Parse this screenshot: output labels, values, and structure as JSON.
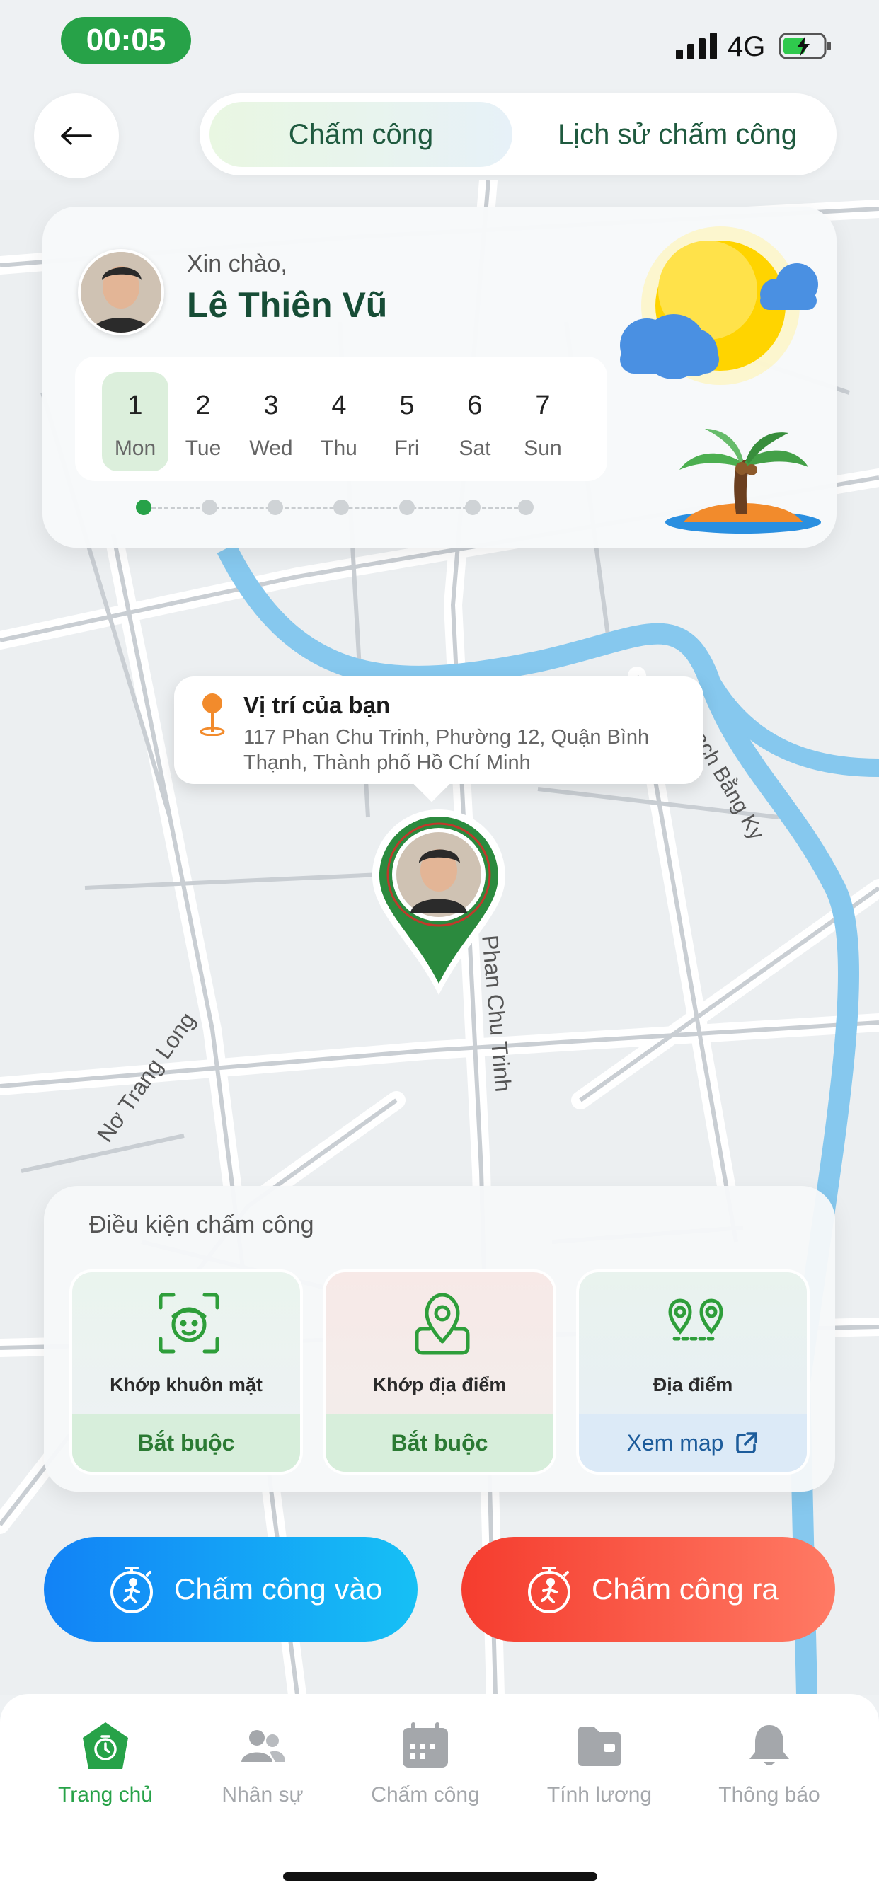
{
  "status_bar": {
    "time": "00:05",
    "network": "4G"
  },
  "header": {
    "tabs": [
      {
        "label": "Chấm công",
        "active": true
      },
      {
        "label": "Lịch sử chấm công",
        "active": false
      }
    ]
  },
  "greeting": {
    "hello": "Xin chào,",
    "name": "Lê Thiên Vũ",
    "week": [
      {
        "num": "1",
        "day": "Mon",
        "active": true
      },
      {
        "num": "2",
        "day": "Tue",
        "active": false
      },
      {
        "num": "3",
        "day": "Wed",
        "active": false
      },
      {
        "num": "4",
        "day": "Thu",
        "active": false
      },
      {
        "num": "5",
        "day": "Fri",
        "active": false
      },
      {
        "num": "6",
        "day": "Sat",
        "active": false
      },
      {
        "num": "7",
        "day": "Sun",
        "active": false
      }
    ]
  },
  "location": {
    "title": "Vị trí của bạn",
    "address": "117 Phan Chu Trinh, Phường 12, Quận Bình Thạnh, Thành phố Hồ Chí Minh"
  },
  "map_labels": {
    "street_1": "Phan Chu Trinh",
    "street_2": "Nơ Trang Long",
    "canal": "Rạch Bằng Ky"
  },
  "conditions": {
    "title": "Điều kiện chấm công",
    "items": [
      {
        "label": "Khớp khuôn mặt",
        "status": "Bắt buộc",
        "icon": "face-scan-icon"
      },
      {
        "label": "Khớp địa điểm",
        "status": "Bắt buộc",
        "icon": "location-pin-icon"
      },
      {
        "label": "Địa điểm",
        "status": "Xem map",
        "icon": "route-pins-icon"
      }
    ]
  },
  "actions": {
    "check_in": "Chấm công vào",
    "check_out": "Chấm công ra"
  },
  "bottom_nav": [
    {
      "label": "Trang chủ",
      "icon": "home-icon",
      "active": true
    },
    {
      "label": "Nhân sự",
      "icon": "people-icon",
      "active": false
    },
    {
      "label": "Chấm công",
      "icon": "calendar-icon",
      "active": false
    },
    {
      "label": "Tính lương",
      "icon": "folder-icon",
      "active": false
    },
    {
      "label": "Thông báo",
      "icon": "bell-icon",
      "active": false
    }
  ],
  "colors": {
    "accent": "#27a248",
    "check_in": "#1282f6",
    "check_out": "#f53c2e"
  }
}
